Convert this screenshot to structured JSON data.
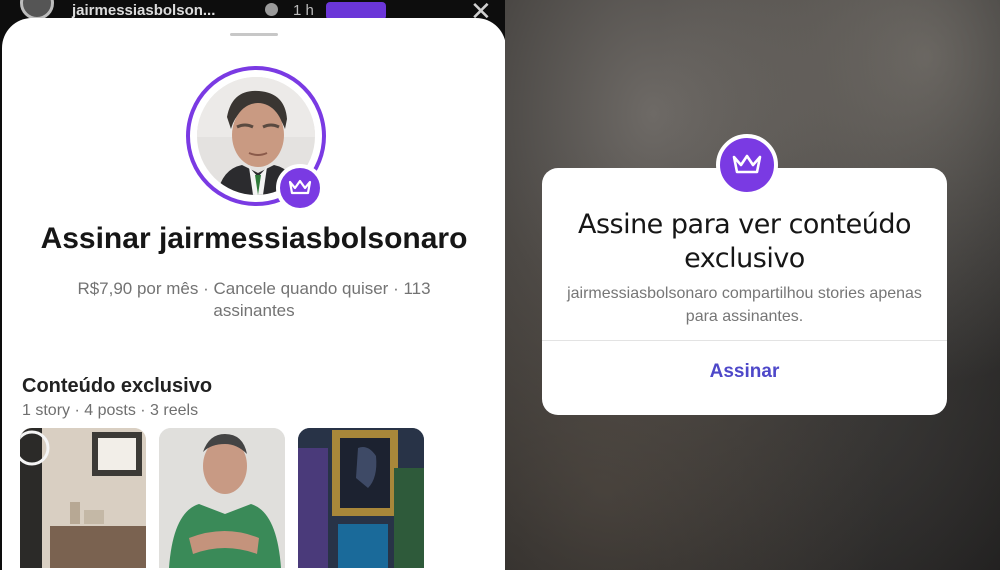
{
  "story_header": {
    "username": "jairmessiasbolson...",
    "time": "1 h"
  },
  "sheet": {
    "title": "Assinar jairmessiasbolsonaro",
    "meta": "R$7,90 por mês · Cancele quando quiser · 113 assinantes",
    "section_title": "Conteúdo exclusivo",
    "section_counts": "1 story · 4 posts · 3 reels"
  },
  "dialog": {
    "title": "Assine para ver conteúdo exclusivo",
    "body": "jairmessiasbolsonaro compartilhou stories apenas para assinantes.",
    "button": "Assinar"
  },
  "colors": {
    "accent": "#7a3ae3",
    "button_text": "#4e48c9"
  },
  "icons": [
    "crown-icon",
    "verified-icon",
    "close-icon"
  ]
}
